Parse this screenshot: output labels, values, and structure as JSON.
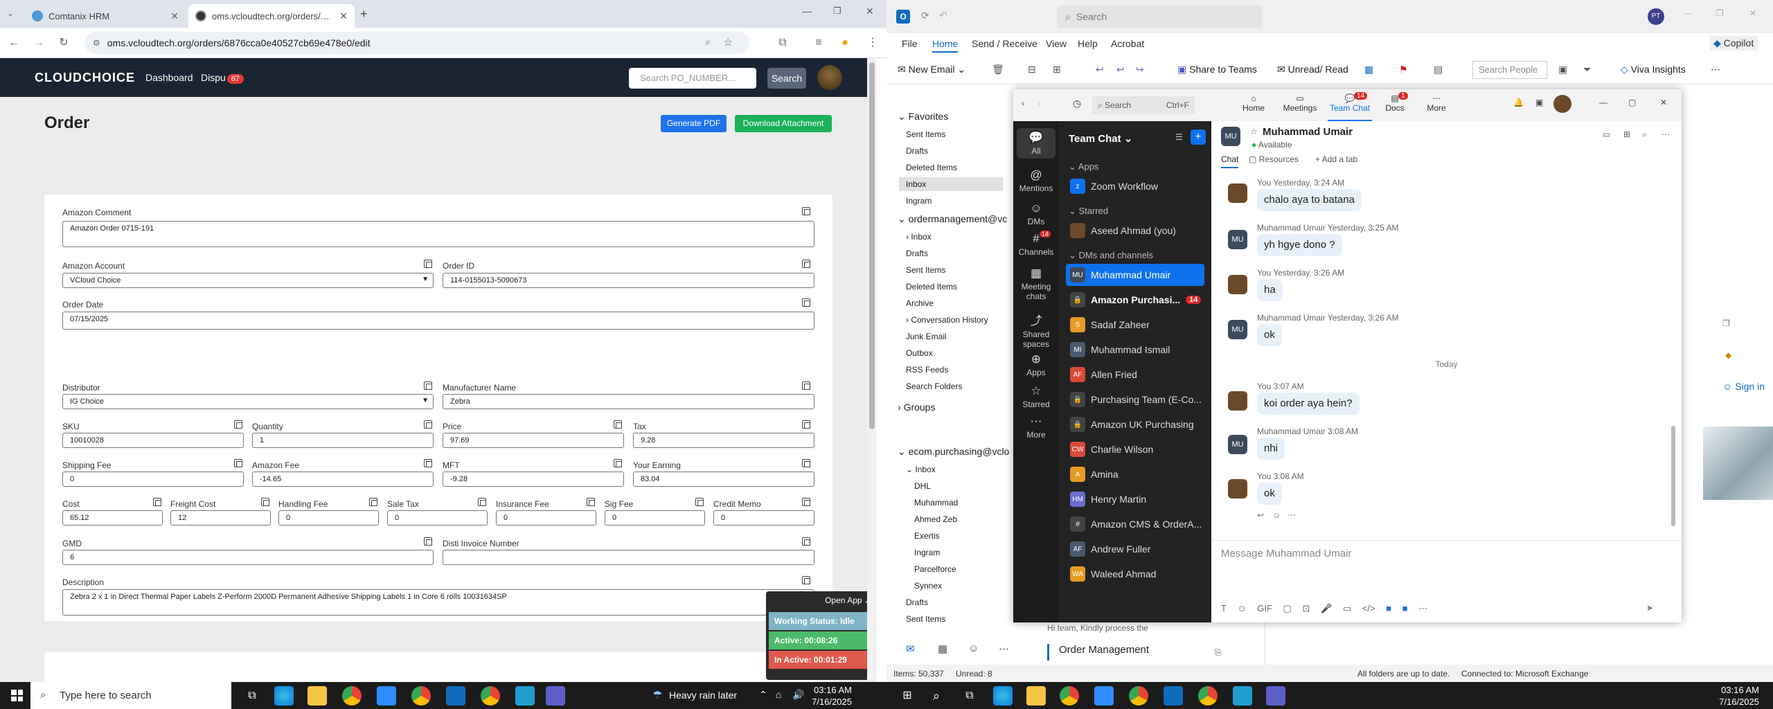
{
  "chrome": {
    "tabs": [
      {
        "title": "Comtanix HRM"
      },
      {
        "title": "oms.vcloudtech.org/orders/687"
      }
    ],
    "url": "oms.vcloudtech.org/orders/6876cca0e40527cb69e478e0/edit"
  },
  "oms": {
    "brand": "CLOUDCHOICE",
    "nav": {
      "dashboard": "Dashboard",
      "disputes": "Dispu",
      "disputes_badge": "67"
    },
    "search_placeholder": "Search PO_NUMBER...",
    "search_button": "Search",
    "page_title": "Order",
    "generate_pdf": "Generate PDF",
    "download_attachment": "Download Attachment",
    "fields": {
      "amazon_comment": {
        "label": "Amazon Comment",
        "value": "Amazon Order 0715-191"
      },
      "amazon_account": {
        "label": "Amazon Account",
        "value": "VCloud Choice"
      },
      "order_id": {
        "label": "Order ID",
        "value": "114-0155013-5090673"
      },
      "order_date": {
        "label": "Order Date",
        "value": "07/15/2025"
      },
      "distributor": {
        "label": "Distributor",
        "value": "IG Choice"
      },
      "manufacturer_name": {
        "label": "Manufacturer Name",
        "value": "Zebra"
      },
      "sku": {
        "label": "SKU",
        "value": "10010028"
      },
      "quantity": {
        "label": "Quantity",
        "value": "1"
      },
      "price": {
        "label": "Price",
        "value": "97.69"
      },
      "tax": {
        "label": "Tax",
        "value": "9.28"
      },
      "shipping_fee": {
        "label": "Shipping Fee",
        "value": "0"
      },
      "amazon_fee": {
        "label": "Amazon Fee",
        "value": "-14.65"
      },
      "mft": {
        "label": "MFT",
        "value": "-9.28"
      },
      "your_earning": {
        "label": "Your Earning",
        "value": "83.04"
      },
      "cost": {
        "label": "Cost",
        "value": "65.12"
      },
      "freight_cost": {
        "label": "Freight Cost",
        "value": "12"
      },
      "handling_fee": {
        "label": "Handling Fee",
        "value": "0"
      },
      "sale_tax": {
        "label": "Sale Tax",
        "value": "0"
      },
      "insurance_fee": {
        "label": "Insurance Fee",
        "value": "0"
      },
      "sig_fee": {
        "label": "Sig Fee",
        "value": "0"
      },
      "credit_memo": {
        "label": "Credit Memo",
        "value": "0"
      },
      "gmd": {
        "label": "GMD",
        "value": "6"
      },
      "disti_invoice": {
        "label": "Disti Invoice Number",
        "value": ""
      },
      "description": {
        "label": "Description",
        "value": "Zebra 2 x 1 in Direct Thermal Paper Labels Z-Perform 2000D Permanent Adhesive Shipping Labels 1 in Core 6 rolls 10031634SP"
      }
    },
    "tracker": {
      "open_app": "Open App ↗",
      "status": "Working Status: Idle",
      "active": "Active: 00:08:26",
      "inactive": "In Active: 00:01:29"
    }
  },
  "outlook": {
    "search": "Search",
    "user_initials": "PT",
    "copilot": "Copilot",
    "menu": [
      "File",
      "Home",
      "Send / Receive",
      "View",
      "Help",
      "Acrobat"
    ],
    "ribbon": {
      "new_email": "New Email",
      "share_to_teams": "Share to Teams",
      "unread_read": "Unread/ Read",
      "search_people": "Search People",
      "viva": "Viva Insights"
    },
    "favorites_header": "Favorites",
    "favorites": [
      "Sent Items",
      "Drafts",
      "Deleted Items",
      "Inbox",
      "Ingram"
    ],
    "account1": "ordermanagement@vc",
    "account1_folders": [
      "Inbox",
      "Drafts",
      "Sent Items",
      "Deleted Items",
      "Archive",
      "Conversation History",
      "Junk Email",
      "Outbox",
      "RSS Feeds",
      "Search Folders"
    ],
    "groups": "Groups",
    "account2": "ecom.purchasing@vclo",
    "account2_folders": [
      "Inbox",
      "DHL",
      "Muhammad",
      "Ahmed Zeb",
      "Exertis",
      "Ingram",
      "Parcelforce",
      "Synnex",
      "Drafts",
      "Sent Items"
    ],
    "preview_snippet": "Hi team,  Kindly process the",
    "preview_sender": "Order Management",
    "signin": "Sign in",
    "status": {
      "items": "Items: 50,337",
      "unread": "Unread: 8",
      "folders_up": "All folders are up to date.",
      "exchange": "Connected to: Microsoft Exchange"
    }
  },
  "zoom": {
    "search": "Search",
    "search_shortcut": "Ctrl+F",
    "tabs": [
      {
        "label": "Home"
      },
      {
        "label": "Meetings"
      },
      {
        "label": "Team Chat",
        "badge": "14"
      },
      {
        "label": "Docs",
        "badge": "1"
      },
      {
        "label": "More"
      }
    ],
    "rail": [
      {
        "label": "All"
      },
      {
        "label": "Mentions"
      },
      {
        "label": "DMs"
      },
      {
        "label": "Channels",
        "badge": "14"
      },
      {
        "label": "Meeting chats"
      },
      {
        "label": "Shared spaces"
      },
      {
        "label": "Apps"
      },
      {
        "label": "Starred"
      },
      {
        "label": "More"
      }
    ],
    "list_title": "Team Chat",
    "sections": {
      "apps": "Apps",
      "starred": "Starred",
      "dms": "DMs and channels"
    },
    "list": {
      "zoom_workflow": "Zoom Workflow",
      "aseed": "Aseed Ahmad (you)",
      "items": [
        {
          "name": "Muhammad Umair",
          "initials": "MU"
        },
        {
          "name": "Amazon Purchasi...",
          "badge": "14"
        },
        {
          "name": "Sadaf Zaheer",
          "initials": "S"
        },
        {
          "name": "Muhammad Ismail",
          "initials": "MI"
        },
        {
          "name": "Allen Fried",
          "initials": "AF"
        },
        {
          "name": "Purchasing Team (E-Co..."
        },
        {
          "name": "Amazon UK Purchasing"
        },
        {
          "name": "Charlie Wilson",
          "initials": "CW"
        },
        {
          "name": "Amina",
          "initials": "A"
        },
        {
          "name": "Henry Martin",
          "initials": "HM"
        },
        {
          "name": "Amazon CMS & OrderA..."
        },
        {
          "name": "Andrew Fuller",
          "initials": "AF"
        },
        {
          "name": "Waleed Ahmad",
          "initials": "WA"
        }
      ]
    },
    "chat": {
      "name": "Muhammad Umair",
      "status": "Available",
      "tab_chat": "Chat",
      "tab_resources": "Resources",
      "add_tab": "+ Add a tab",
      "today": "Today",
      "messages": [
        {
          "meta": "You Yesterday, 3:24 AM",
          "text": "chalo aya to batana"
        },
        {
          "meta": "Muhammad Umair Yesterday, 3:25 AM",
          "text": "yh hgye dono ?"
        },
        {
          "meta": "You Yesterday, 3:26 AM",
          "text": "ha"
        },
        {
          "meta": "Muhammad Umair Yesterday, 3:26 AM",
          "text": "ok"
        },
        {
          "meta": "You 3:07 AM",
          "text": "koi order aya hein?"
        },
        {
          "meta": "Muhammad Umair 3:08 AM",
          "text": "nhi"
        },
        {
          "meta": "You 3:08 AM",
          "text": "ok"
        }
      ],
      "composer_placeholder": "Message Muhammad Umair"
    }
  },
  "taskbar": {
    "search": "Type here to search",
    "weather": "Heavy rain later",
    "time_left": "03:16 AM",
    "date_left": "7/16/2025",
    "time_right": "03:16 AM",
    "date_right": "7/16/2025"
  }
}
